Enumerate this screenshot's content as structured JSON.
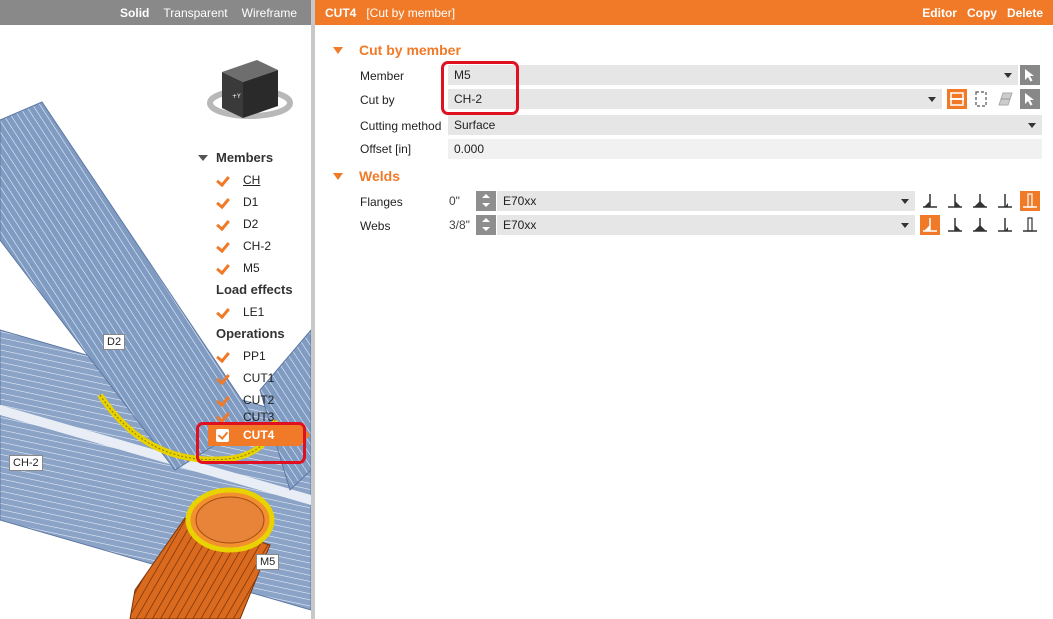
{
  "view_toolbar": {
    "solid": "Solid",
    "transparent": "Transparent",
    "wireframe": "Wireframe"
  },
  "view_labels": {
    "d2": "D2",
    "ch2": "CH-2",
    "m5": "M5"
  },
  "tree": {
    "members_title": "Members",
    "members": [
      "CH",
      "D1",
      "D2",
      "CH-2",
      "M5"
    ],
    "load_title": "Load effects",
    "loads": [
      "LE1"
    ],
    "ops_title": "Operations",
    "ops": [
      "PP1",
      "CUT1",
      "CUT2",
      "CUT3"
    ],
    "selected": "CUT4"
  },
  "header": {
    "title": "CUT4",
    "subtitle": "[Cut by member]",
    "editor": "Editor",
    "copy": "Copy",
    "delete": "Delete"
  },
  "cut": {
    "section": "Cut by member",
    "member_label": "Member",
    "member_value": "M5",
    "cutby_label": "Cut by",
    "cutby_value": "CH-2",
    "method_label": "Cutting method",
    "method_value": "Surface",
    "offset_label": "Offset [in]",
    "offset_value": "0.000"
  },
  "welds": {
    "section": "Welds",
    "flanges_label": "Flanges",
    "flanges_size": "0\"",
    "flanges_value": "E70xx",
    "webs_label": "Webs",
    "webs_size": "3/8\"",
    "webs_value": "E70xx"
  },
  "colors": {
    "accent": "#f07a28",
    "highlight": "#e01020",
    "toolbar": "#898989"
  }
}
